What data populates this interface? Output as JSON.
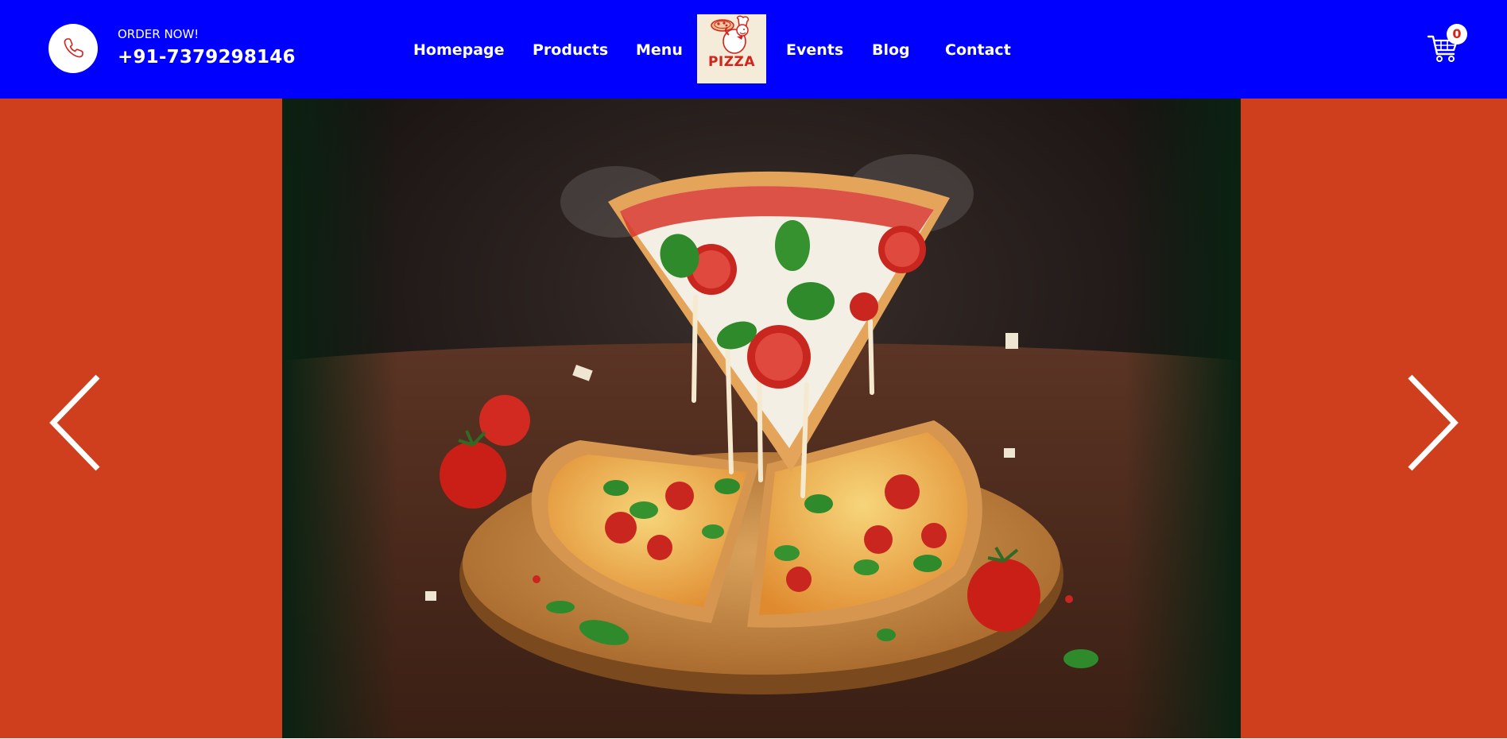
{
  "header": {
    "order_label": "ORDER NOW!",
    "phone_number": "+91-7379298146",
    "nav": {
      "homepage": "Homepage",
      "products": "Products",
      "menu": "Menu",
      "events": "Events",
      "blog": "Blog",
      "contact": "Contact"
    },
    "logo_text": "PIZZA",
    "cart_count": "0",
    "icons": {
      "phone": "phone-icon",
      "cart": "cart-icon",
      "logo": "pizza-chef-logo"
    }
  },
  "hero": {
    "slide_image": "pizza-slice-cheese-pull-photo",
    "prev_icon": "chevron-left-icon",
    "next_icon": "chevron-right-icon"
  },
  "colors": {
    "header_bg": "#0000ff",
    "hero_bg": "#cf3f1e",
    "accent": "#d0241c",
    "text": "#ffffff"
  }
}
